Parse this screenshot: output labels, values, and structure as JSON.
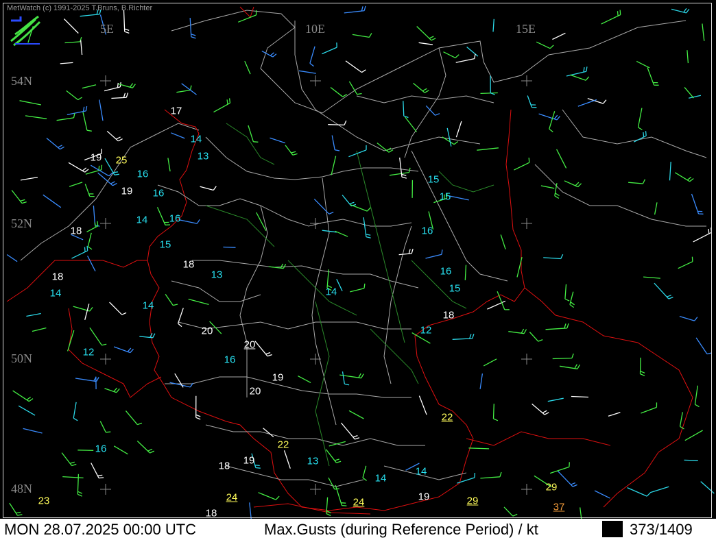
{
  "copyright": "MetWatch  (c) 1991-2025 T.Bruns, B.Richter",
  "logo_icon": "metwatch-logo-icon",
  "grid_labels": {
    "lon": [
      "5E",
      "10E",
      "15E"
    ],
    "lat": [
      "54N",
      "52N",
      "50N",
      "48N"
    ]
  },
  "status": {
    "datetime": "MON 28.07.2025 00:00 UTC",
    "parameter": "Max.Gusts (during Reference Period) / kt",
    "counter": "373/1409"
  },
  "colors": {
    "white": "#ffffff",
    "cyan": "#27e0f0",
    "yellow": "#fffc5a",
    "orange": "#f09a3a",
    "border_red": "#e01010",
    "admin_gray": "#aaaaaa",
    "green": "#3dbd3d",
    "wind_green": "#44ee44",
    "wind_blue": "#3a8cff",
    "wind_cyan": "#2bd8e8"
  },
  "gust_values": [
    {
      "v": "17",
      "c": "white"
    },
    {
      "v": "14",
      "c": "cyan"
    },
    {
      "v": "13",
      "c": "cyan"
    },
    {
      "v": "19",
      "c": "white"
    },
    {
      "v": "25",
      "c": "yellow"
    },
    {
      "v": "16",
      "c": "cyan"
    },
    {
      "v": "19",
      "c": "white"
    },
    {
      "v": "16",
      "c": "cyan"
    },
    {
      "v": "14",
      "c": "cyan"
    },
    {
      "v": "16",
      "c": "cyan"
    },
    {
      "v": "18",
      "c": "white"
    },
    {
      "v": "15",
      "c": "cyan"
    },
    {
      "v": "18",
      "c": "white"
    },
    {
      "v": "13",
      "c": "cyan"
    },
    {
      "v": "18",
      "c": "white"
    },
    {
      "v": "14",
      "c": "cyan"
    },
    {
      "v": "14",
      "c": "cyan"
    },
    {
      "v": "14",
      "c": "cyan"
    },
    {
      "v": "20",
      "c": "white"
    },
    {
      "v": "20",
      "c": "white",
      "u": true
    },
    {
      "v": "16",
      "c": "cyan"
    },
    {
      "v": "12",
      "c": "cyan"
    },
    {
      "v": "19",
      "c": "white"
    },
    {
      "v": "20",
      "c": "white"
    },
    {
      "v": "15",
      "c": "cyan"
    },
    {
      "v": "15",
      "c": "cyan"
    },
    {
      "v": "16",
      "c": "cyan"
    },
    {
      "v": "16",
      "c": "cyan"
    },
    {
      "v": "15",
      "c": "cyan"
    },
    {
      "v": "18",
      "c": "white"
    },
    {
      "v": "12",
      "c": "cyan"
    },
    {
      "v": "22",
      "c": "yellow",
      "u": true
    },
    {
      "v": "16",
      "c": "cyan"
    },
    {
      "v": "22",
      "c": "yellow"
    },
    {
      "v": "13",
      "c": "cyan"
    },
    {
      "v": "19",
      "c": "white"
    },
    {
      "v": "18",
      "c": "white"
    },
    {
      "v": "14",
      "c": "cyan"
    },
    {
      "v": "14",
      "c": "cyan"
    },
    {
      "v": "24",
      "c": "yellow",
      "u": true
    },
    {
      "v": "24",
      "c": "yellow",
      "u": true
    },
    {
      "v": "19",
      "c": "white"
    },
    {
      "v": "29",
      "c": "yellow",
      "u": true
    },
    {
      "v": "29",
      "c": "yellow"
    },
    {
      "v": "37",
      "c": "orange",
      "u": true
    },
    {
      "v": "23",
      "c": "yellow"
    },
    {
      "v": "18",
      "c": "white"
    }
  ]
}
